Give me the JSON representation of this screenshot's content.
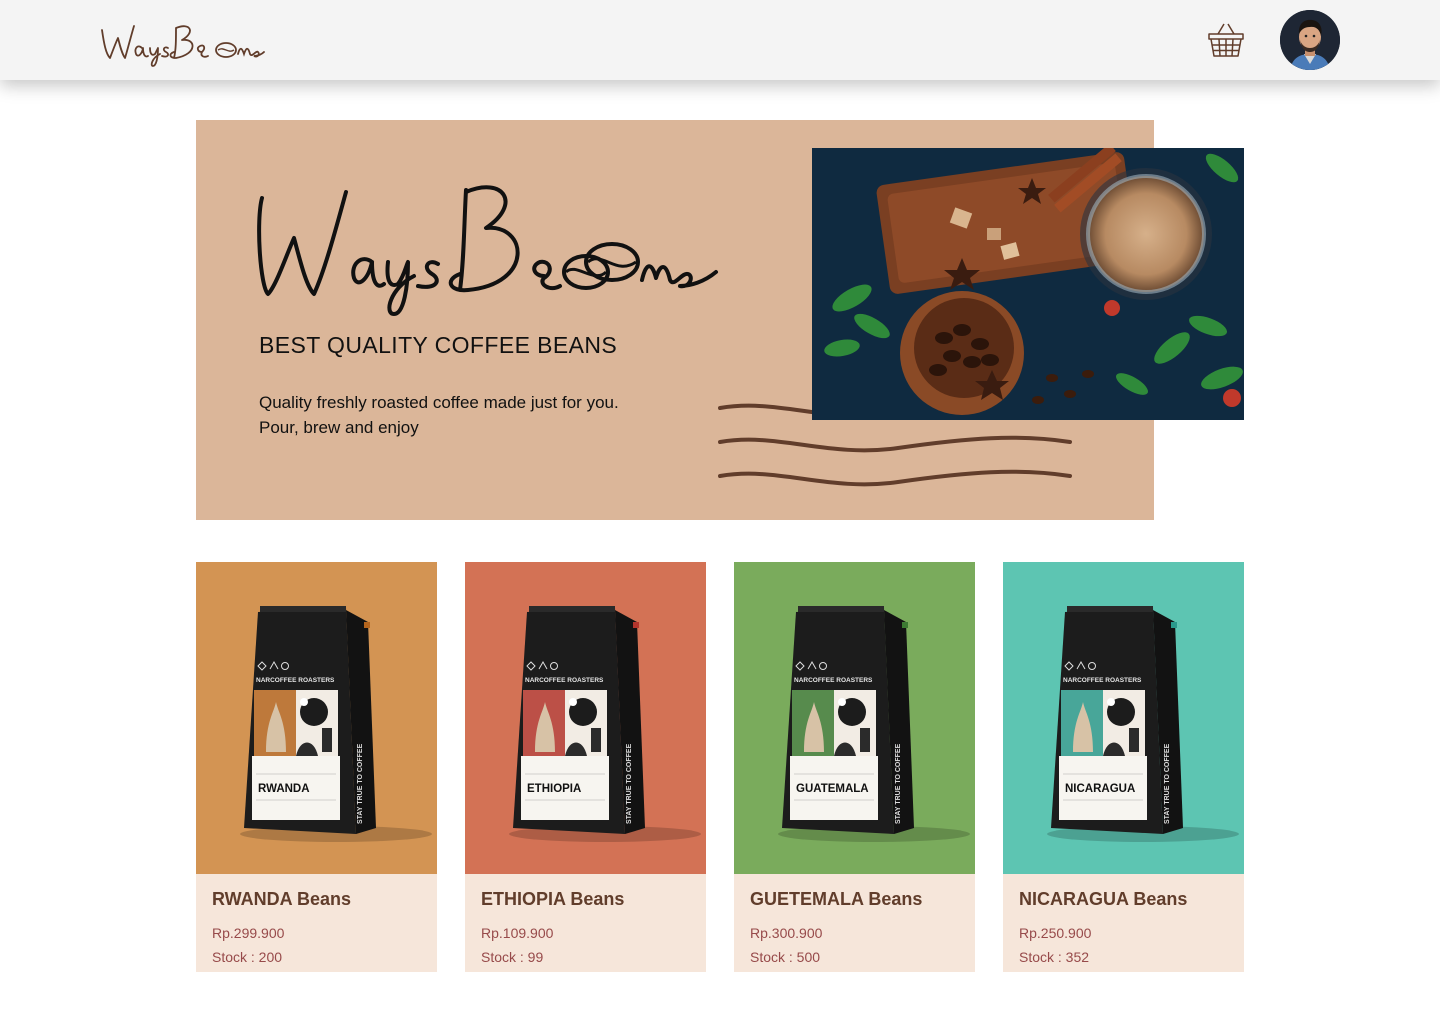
{
  "header": {
    "logo_text": "WaysBeans",
    "cart_icon": "basket-icon",
    "avatar": "user-avatar"
  },
  "hero": {
    "logo_text": "WaysBeans",
    "title": "BEST QUALITY COFFEE BEANS",
    "description_line1": "Quality freshly roasted coffee made just for you.",
    "description_line2": "Pour, brew and enjoy"
  },
  "products": [
    {
      "name": "RWANDA Beans",
      "price": "Rp.299.900",
      "stock": "Stock : 200",
      "bg": "#d39453",
      "label": "RWANDA",
      "accent": "#b5651d"
    },
    {
      "name": "ETHIOPIA Beans",
      "price": "Rp.109.900",
      "stock": "Stock : 99",
      "bg": "#d37255",
      "label": "ETHIOPIA",
      "accent": "#b3352c"
    },
    {
      "name": "GUETEMALA Beans",
      "price": "Rp.300.900",
      "stock": "Stock : 500",
      "bg": "#7aab5c",
      "label": "GUATEMALA",
      "accent": "#3c7a32"
    },
    {
      "name": "NICARAGUA Beans",
      "price": "Rp.250.900",
      "stock": "Stock : 352",
      "bg": "#5dc5b2",
      "label": "NICARAGUA",
      "accent": "#2a9a8c"
    }
  ],
  "bag_brand": "NARCOFFEE ROASTERS",
  "bag_side": "STAY TRUE TO COFFEE",
  "colors": {
    "brand_brown": "#613d2b",
    "hero_bg": "#dbb699",
    "card_bg": "#f6e6da",
    "price_red": "#974a4a"
  }
}
